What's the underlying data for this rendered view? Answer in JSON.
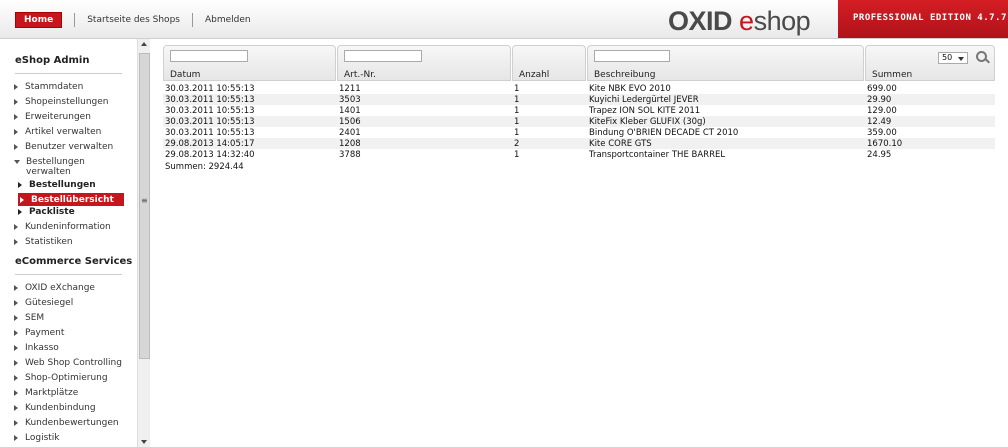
{
  "header": {
    "nav": [
      "Home",
      "Startseite des Shops",
      "Abmelden"
    ],
    "brand_oxid": "OXID",
    "brand_e": "e",
    "brand_shop": "shop",
    "edition": "PROFESSIONAL EDITION 4.7.7"
  },
  "sidebar": {
    "section1": "eShop Admin",
    "items1": [
      "Stammdaten",
      "Shopeinstellungen",
      "Erweiterungen",
      "Artikel verwalten",
      "Benutzer verwalten"
    ],
    "expanded_label_line1": "Bestellungen",
    "expanded_label_line2": "verwalten",
    "subitems": [
      "Bestellungen",
      "Bestellübersicht",
      "Packliste"
    ],
    "items2": [
      "Kundeninformation",
      "Statistiken"
    ],
    "section2": "eCommerce Services",
    "items3": [
      "OXID eXchange",
      "Gütesiegel",
      "SEM",
      "Payment",
      "Inkasso",
      "Web Shop Controlling",
      "Shop-Optimierung",
      "Marktplätze",
      "Kundenbindung",
      "Kundenbewertungen",
      "Logistik"
    ]
  },
  "filters": {
    "columns": [
      "Datum",
      "Art.-Nr.",
      "Anzahl",
      "Beschreibung",
      "Summen"
    ],
    "page_size": "50"
  },
  "table": {
    "rows": [
      [
        "30.03.2011 10:55:13",
        "1211",
        "1",
        "Kite NBK EVO 2010",
        "699.00"
      ],
      [
        "30.03.2011 10:55:13",
        "3503",
        "1",
        "Kuyichi Ledergürtel JEVER",
        "29.90"
      ],
      [
        "30.03.2011 10:55:13",
        "1401",
        "1",
        "Trapez ION SOL KITE 2011",
        "129.00"
      ],
      [
        "30.03.2011 10:55:13",
        "1506",
        "1",
        "KiteFix Kleber GLUFIX (30g)",
        "12.49"
      ],
      [
        "30.03.2011 10:55:13",
        "2401",
        "1",
        "Bindung O'BRIEN DECADE CT 2010",
        "359.00"
      ],
      [
        "29.08.2013 14:05:17",
        "1208",
        "2",
        "Kite CORE GTS",
        "1670.10"
      ],
      [
        "29.08.2013 14:32:40",
        "3788",
        "1",
        "Transportcontainer THE BARREL",
        "24.95"
      ]
    ],
    "total": "Summen: 2924.44"
  },
  "colors": {
    "accent": "#c4161c"
  }
}
